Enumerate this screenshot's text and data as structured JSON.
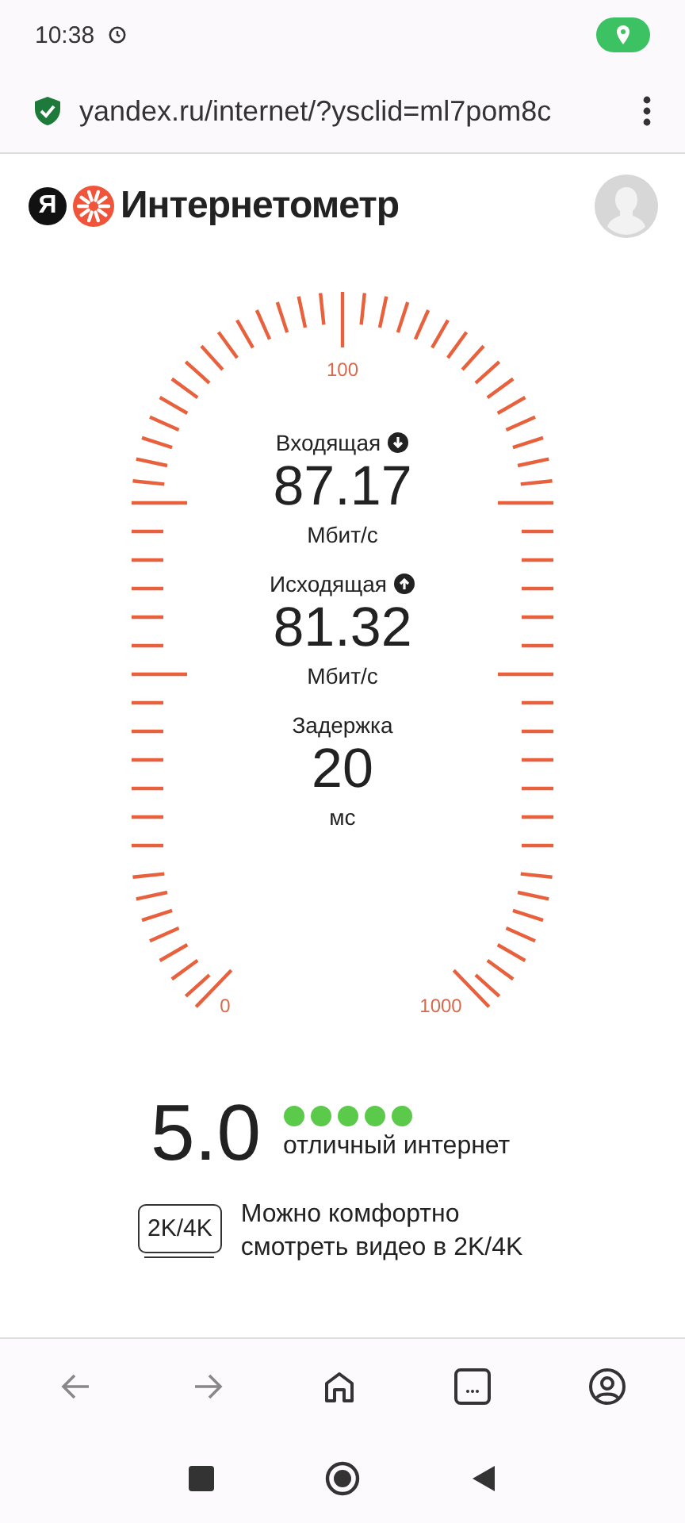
{
  "status_bar": {
    "time": "10:38"
  },
  "address_bar": {
    "url": "yandex.ru/internet/?ysclid=ml7pom8c"
  },
  "header": {
    "logo_letter": "Я",
    "title": "Интернетометр"
  },
  "gauge": {
    "scale_labels": [
      "100",
      "0",
      "1000"
    ],
    "readings": [
      {
        "label": "Входящая",
        "kind": "download",
        "value": "87.17",
        "unit": "Мбит/с"
      },
      {
        "label": "Исходящая",
        "kind": "upload",
        "value": "81.32",
        "unit": "Мбит/с"
      },
      {
        "label": "Задержка",
        "kind": "latency",
        "value": "20",
        "unit": "мс"
      }
    ]
  },
  "rating": {
    "score": "5.0",
    "stars": 5,
    "verdict": "отличный интернет"
  },
  "quality": {
    "badge": "2K/4K",
    "text": "Можно комфортно смотреть видео в 2K/4K"
  }
}
